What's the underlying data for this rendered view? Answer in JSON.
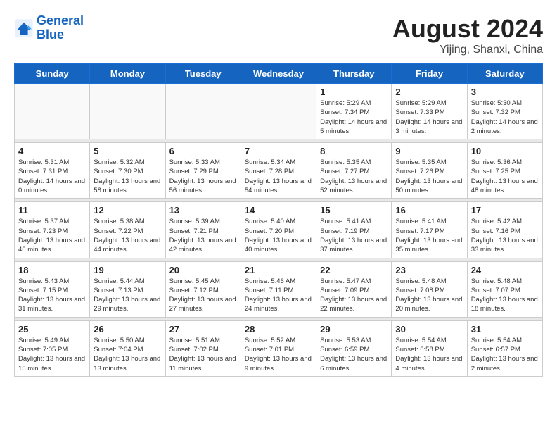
{
  "header": {
    "logo_line1": "General",
    "logo_line2": "Blue",
    "month_title": "August 2024",
    "location": "Yijing, Shanxi, China"
  },
  "weekdays": [
    "Sunday",
    "Monday",
    "Tuesday",
    "Wednesday",
    "Thursday",
    "Friday",
    "Saturday"
  ],
  "weeks": [
    {
      "days": [
        {
          "num": "",
          "info": ""
        },
        {
          "num": "",
          "info": ""
        },
        {
          "num": "",
          "info": ""
        },
        {
          "num": "",
          "info": ""
        },
        {
          "num": "1",
          "info": "Sunrise: 5:29 AM\nSunset: 7:34 PM\nDaylight: 14 hours\nand 5 minutes."
        },
        {
          "num": "2",
          "info": "Sunrise: 5:29 AM\nSunset: 7:33 PM\nDaylight: 14 hours\nand 3 minutes."
        },
        {
          "num": "3",
          "info": "Sunrise: 5:30 AM\nSunset: 7:32 PM\nDaylight: 14 hours\nand 2 minutes."
        }
      ]
    },
    {
      "days": [
        {
          "num": "4",
          "info": "Sunrise: 5:31 AM\nSunset: 7:31 PM\nDaylight: 14 hours\nand 0 minutes."
        },
        {
          "num": "5",
          "info": "Sunrise: 5:32 AM\nSunset: 7:30 PM\nDaylight: 13 hours\nand 58 minutes."
        },
        {
          "num": "6",
          "info": "Sunrise: 5:33 AM\nSunset: 7:29 PM\nDaylight: 13 hours\nand 56 minutes."
        },
        {
          "num": "7",
          "info": "Sunrise: 5:34 AM\nSunset: 7:28 PM\nDaylight: 13 hours\nand 54 minutes."
        },
        {
          "num": "8",
          "info": "Sunrise: 5:35 AM\nSunset: 7:27 PM\nDaylight: 13 hours\nand 52 minutes."
        },
        {
          "num": "9",
          "info": "Sunrise: 5:35 AM\nSunset: 7:26 PM\nDaylight: 13 hours\nand 50 minutes."
        },
        {
          "num": "10",
          "info": "Sunrise: 5:36 AM\nSunset: 7:25 PM\nDaylight: 13 hours\nand 48 minutes."
        }
      ]
    },
    {
      "days": [
        {
          "num": "11",
          "info": "Sunrise: 5:37 AM\nSunset: 7:23 PM\nDaylight: 13 hours\nand 46 minutes."
        },
        {
          "num": "12",
          "info": "Sunrise: 5:38 AM\nSunset: 7:22 PM\nDaylight: 13 hours\nand 44 minutes."
        },
        {
          "num": "13",
          "info": "Sunrise: 5:39 AM\nSunset: 7:21 PM\nDaylight: 13 hours\nand 42 minutes."
        },
        {
          "num": "14",
          "info": "Sunrise: 5:40 AM\nSunset: 7:20 PM\nDaylight: 13 hours\nand 40 minutes."
        },
        {
          "num": "15",
          "info": "Sunrise: 5:41 AM\nSunset: 7:19 PM\nDaylight: 13 hours\nand 37 minutes."
        },
        {
          "num": "16",
          "info": "Sunrise: 5:41 AM\nSunset: 7:17 PM\nDaylight: 13 hours\nand 35 minutes."
        },
        {
          "num": "17",
          "info": "Sunrise: 5:42 AM\nSunset: 7:16 PM\nDaylight: 13 hours\nand 33 minutes."
        }
      ]
    },
    {
      "days": [
        {
          "num": "18",
          "info": "Sunrise: 5:43 AM\nSunset: 7:15 PM\nDaylight: 13 hours\nand 31 minutes."
        },
        {
          "num": "19",
          "info": "Sunrise: 5:44 AM\nSunset: 7:13 PM\nDaylight: 13 hours\nand 29 minutes."
        },
        {
          "num": "20",
          "info": "Sunrise: 5:45 AM\nSunset: 7:12 PM\nDaylight: 13 hours\nand 27 minutes."
        },
        {
          "num": "21",
          "info": "Sunrise: 5:46 AM\nSunset: 7:11 PM\nDaylight: 13 hours\nand 24 minutes."
        },
        {
          "num": "22",
          "info": "Sunrise: 5:47 AM\nSunset: 7:09 PM\nDaylight: 13 hours\nand 22 minutes."
        },
        {
          "num": "23",
          "info": "Sunrise: 5:48 AM\nSunset: 7:08 PM\nDaylight: 13 hours\nand 20 minutes."
        },
        {
          "num": "24",
          "info": "Sunrise: 5:48 AM\nSunset: 7:07 PM\nDaylight: 13 hours\nand 18 minutes."
        }
      ]
    },
    {
      "days": [
        {
          "num": "25",
          "info": "Sunrise: 5:49 AM\nSunset: 7:05 PM\nDaylight: 13 hours\nand 15 minutes."
        },
        {
          "num": "26",
          "info": "Sunrise: 5:50 AM\nSunset: 7:04 PM\nDaylight: 13 hours\nand 13 minutes."
        },
        {
          "num": "27",
          "info": "Sunrise: 5:51 AM\nSunset: 7:02 PM\nDaylight: 13 hours\nand 11 minutes."
        },
        {
          "num": "28",
          "info": "Sunrise: 5:52 AM\nSunset: 7:01 PM\nDaylight: 13 hours\nand 9 minutes."
        },
        {
          "num": "29",
          "info": "Sunrise: 5:53 AM\nSunset: 6:59 PM\nDaylight: 13 hours\nand 6 minutes."
        },
        {
          "num": "30",
          "info": "Sunrise: 5:54 AM\nSunset: 6:58 PM\nDaylight: 13 hours\nand 4 minutes."
        },
        {
          "num": "31",
          "info": "Sunrise: 5:54 AM\nSunset: 6:57 PM\nDaylight: 13 hours\nand 2 minutes."
        }
      ]
    }
  ]
}
